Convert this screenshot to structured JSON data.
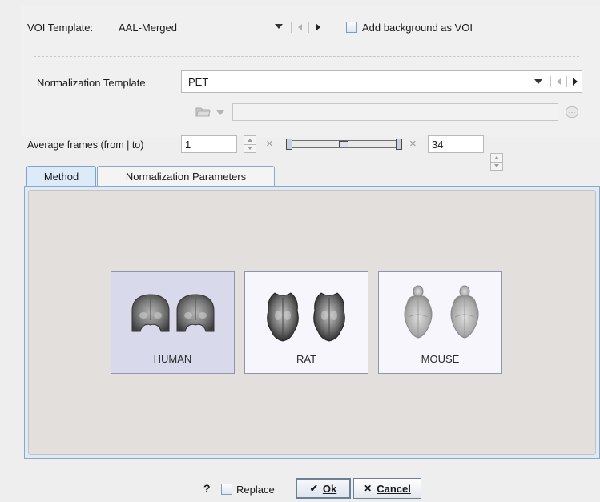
{
  "voi": {
    "label": "VOI Template:",
    "value": "AAL-Merged",
    "add_background_label": "Add background as VOI",
    "add_background_checked": false
  },
  "normalization": {
    "label": "Normalization Template",
    "value": "PET",
    "path_value": ""
  },
  "average_frames": {
    "label": "Average frames (from | to)",
    "from": "1",
    "times_symbol": "×",
    "to": "34"
  },
  "tabs": [
    {
      "label": "Method",
      "active": true
    },
    {
      "label": "Normalization Parameters",
      "active": false
    }
  ],
  "species": [
    {
      "label": "HUMAN",
      "selected": true
    },
    {
      "label": "RAT",
      "selected": false
    },
    {
      "label": "MOUSE",
      "selected": false
    }
  ],
  "footer": {
    "help": "?",
    "replace_label": "Replace",
    "replace_checked": false,
    "ok_check": "✔",
    "ok_label": "Ok",
    "cancel_x": "✕",
    "cancel_label": "Cancel"
  },
  "colors": {
    "panel_bg": "#e3dfdc",
    "panel_border": "#8fa7c5",
    "selected_card": "#d9d9ec",
    "card_bg": "#f7f6fc"
  }
}
